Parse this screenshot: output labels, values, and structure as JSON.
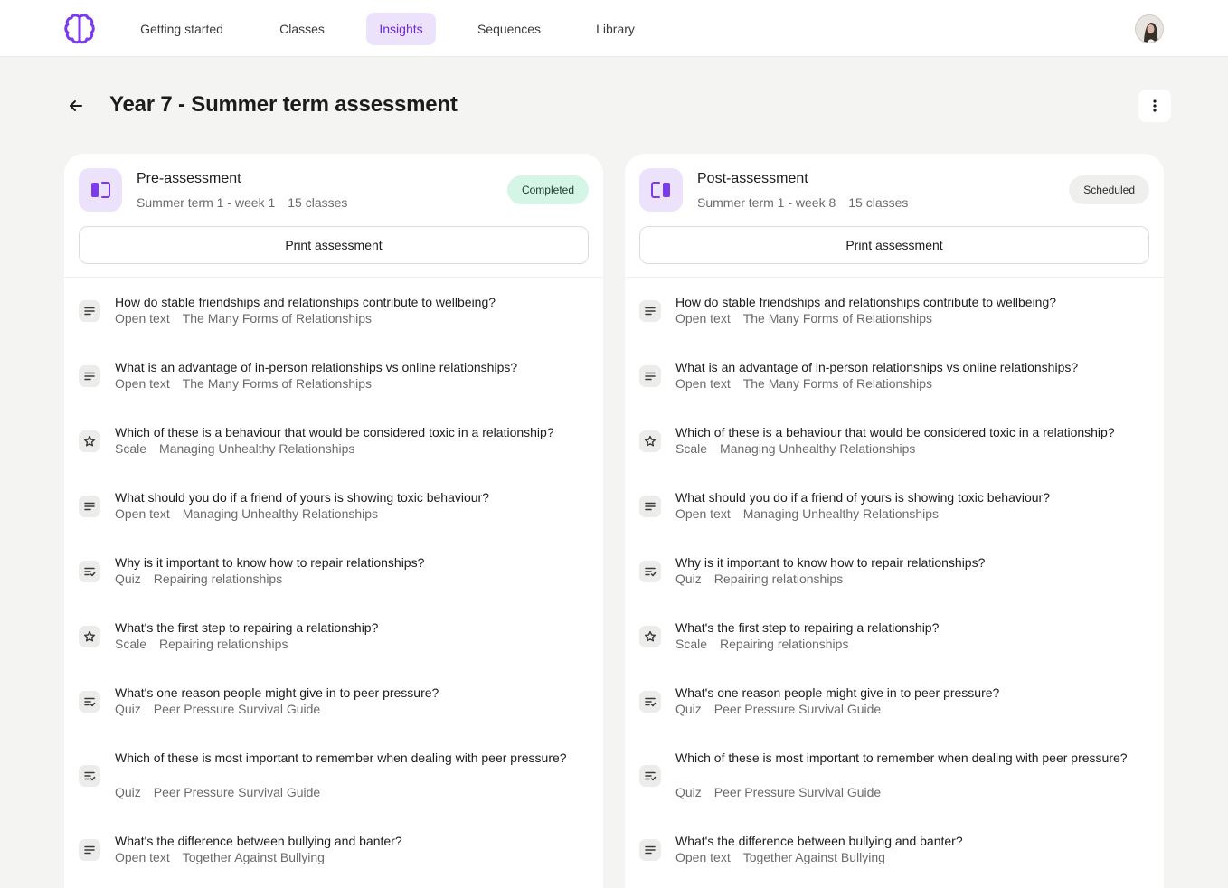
{
  "nav": {
    "items": [
      {
        "label": "Getting started",
        "active": false
      },
      {
        "label": "Classes",
        "active": false
      },
      {
        "label": "Insights",
        "active": true
      },
      {
        "label": "Sequences",
        "active": false
      },
      {
        "label": "Library",
        "active": false
      }
    ]
  },
  "page": {
    "title": "Year 7 - Summer term assessment"
  },
  "colors": {
    "accent": "#6d28d9",
    "accent_soft": "#ece2fb",
    "completed_bg": "#d5f5e6",
    "page_bg": "#f4f4f2"
  },
  "panels": [
    {
      "title": "Pre-assessment",
      "term": "Summer term 1 - week 1",
      "classes": "15 classes",
      "status": "Completed",
      "icon": "columns-left-icon",
      "print_label": "Print assessment"
    },
    {
      "title": "Post-assessment",
      "term": "Summer term 1 - week 8",
      "classes": "15 classes",
      "status": "Scheduled",
      "icon": "columns-right-icon",
      "print_label": "Print assessment"
    }
  ],
  "questions": [
    {
      "text": "How do stable friendships and relationships contribute to wellbeing?",
      "type": "Open text",
      "topic": "The Many Forms of Relationships",
      "icon": "text-lines-icon"
    },
    {
      "text": "What is an advantage of in-person relationships vs online relationships?",
      "type": "Open text",
      "topic": "The Many Forms of Relationships",
      "icon": "text-lines-icon"
    },
    {
      "text": "Which of these is a behaviour that would be considered toxic in a relationship?",
      "type": "Scale",
      "topic": "Managing Unhealthy Relationships",
      "icon": "star-icon"
    },
    {
      "text": "What should you do if a friend of yours is showing toxic behaviour?",
      "type": "Open text",
      "topic": "Managing Unhealthy Relationships",
      "icon": "text-lines-icon"
    },
    {
      "text": "Why is it important to know how to repair relationships?",
      "type": "Quiz",
      "topic": "Repairing relationships",
      "icon": "list-check-icon"
    },
    {
      "text": "What's the first step to repairing a relationship?",
      "type": "Scale",
      "topic": "Repairing relationships",
      "icon": "star-icon"
    },
    {
      "text": "What's one reason people might give in to peer pressure?",
      "type": "Quiz",
      "topic": "Peer Pressure Survival Guide",
      "icon": "list-check-icon"
    },
    {
      "text": "Which of these is most important to remember when dealing with peer pressure?",
      "type": "Quiz",
      "topic": "Peer Pressure Survival Guide",
      "icon": "list-check-icon"
    },
    {
      "text": "What's the difference between bullying and banter?",
      "type": "Open text",
      "topic": "Together Against Bullying",
      "icon": "text-lines-icon"
    }
  ]
}
